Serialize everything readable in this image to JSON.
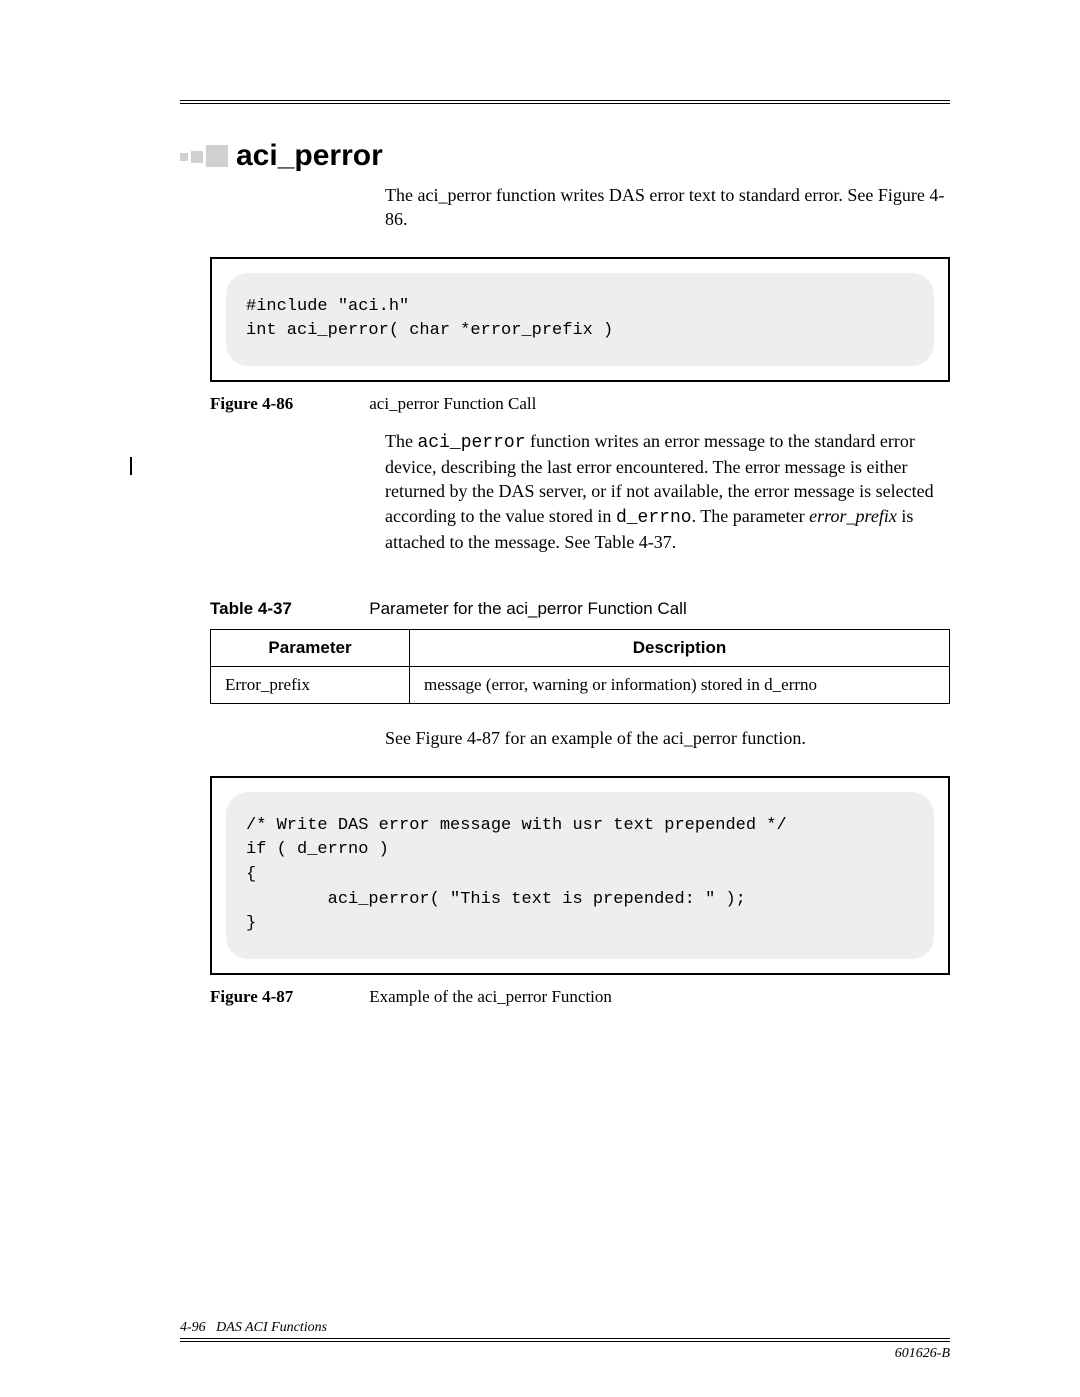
{
  "heading": "aci_perror",
  "intro": "The aci_perror function writes DAS error text to standard error. See Figure 4-86.",
  "code1": "#include \"aci.h\"\nint aci_perror( char *error_prefix )",
  "fig86_label": "Figure 4-86",
  "fig86_text": "aci_perror Function Call",
  "para2_pre": "The ",
  "para2_func": "aci_perror",
  "para2_mid": " function writes an error message to the standard error device, describing the last error encountered. The error message is either returned by the DAS server, or if not available, the error message is selected according to the value stored in ",
  "para2_derrno": "d_errno",
  "para2_after": ". The parameter ",
  "para2_param": "error_prefix",
  "para2_end": " is attached to the message. See Table 4-37.",
  "tbl_label": "Table 4-37",
  "tbl_text": "Parameter for the aci_perror Function Call",
  "tbl_h1": "Parameter",
  "tbl_h2": "Description",
  "tbl_r1c1": "Error_prefix",
  "tbl_r1c2": "message (error, warning or information) stored in d_errno",
  "see_fig": "See Figure 4-87 for an example of the aci_perror function.",
  "code2": "/* Write DAS error message with usr text prepended */\nif ( d_errno )\n{\n        aci_perror( \"This text is prepended: \" );\n}",
  "fig87_label": "Figure 4-87",
  "fig87_text": "Example of the aci_perror Function",
  "footer_left_page": "4-96",
  "footer_left_title": "DAS ACI Functions",
  "footer_right": "601626-B"
}
